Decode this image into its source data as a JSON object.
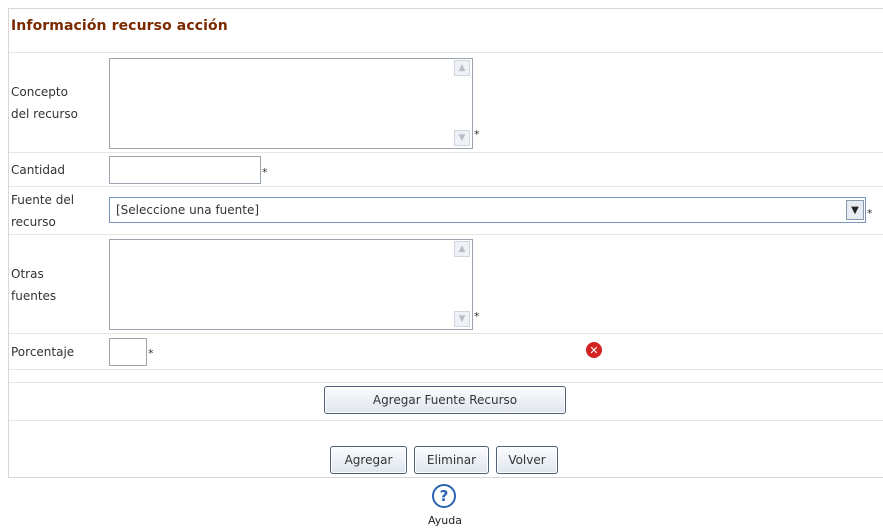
{
  "form": {
    "title": "Información recurso acción",
    "required_mark": "*",
    "fields": {
      "concepto": {
        "label_line1": "Concepto",
        "label_line2": "del recurso",
        "value": ""
      },
      "cantidad": {
        "label": "Cantidad",
        "value": ""
      },
      "fuente": {
        "label_line1": "Fuente del",
        "label_line2": "recurso",
        "selected": "[Seleccione una fuente]"
      },
      "otras": {
        "label_line1": "Otras",
        "label_line2": "fuentes",
        "value": ""
      },
      "porcentaje": {
        "label": "Porcentaje",
        "value": ""
      }
    },
    "buttons": {
      "add_source": "Agregar Fuente Recurso",
      "add": "Agregar",
      "delete": "Eliminar",
      "back": "Volver"
    },
    "help": {
      "label": "Ayuda"
    }
  },
  "icons": {
    "delete_icon": "close-icon",
    "help_icon": "help-icon",
    "scroll_up": "scroll-up-icon",
    "scroll_down": "scroll-down-icon",
    "select_arrow": "chevron-down-icon"
  },
  "colors": {
    "title": "#7a2a00",
    "border": "#d7d7d7",
    "error_icon": "#d32424",
    "help_icon": "#2a64b5"
  }
}
